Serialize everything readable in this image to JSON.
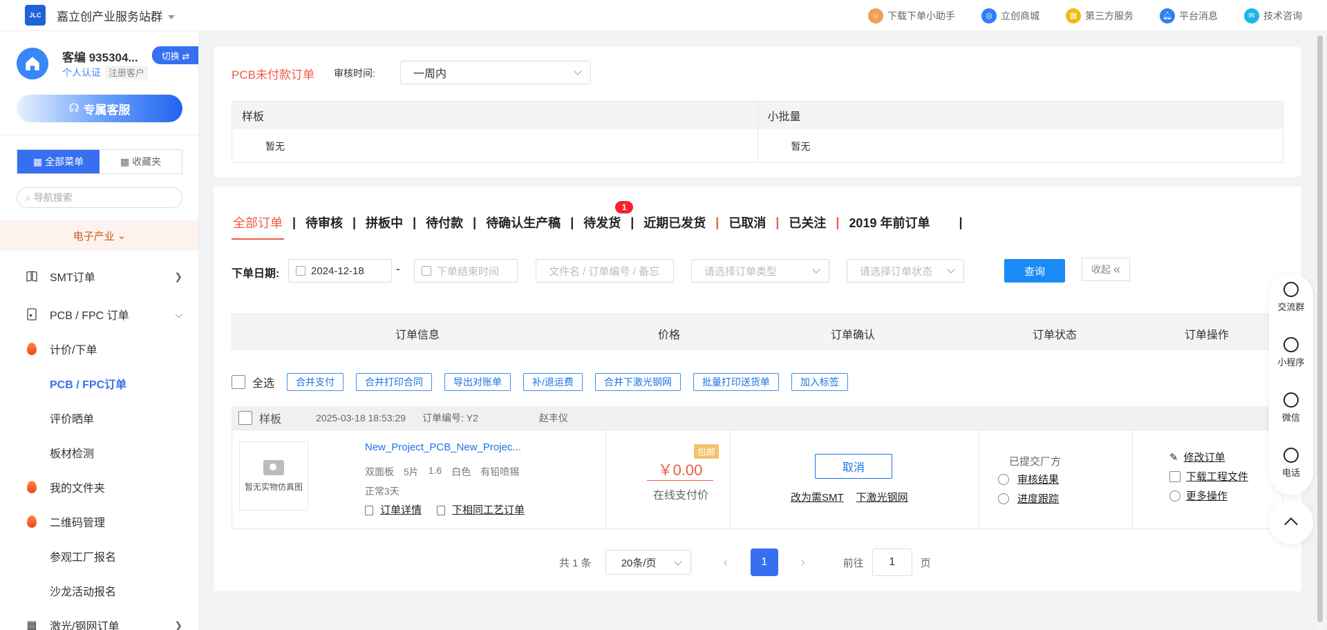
{
  "topbar": {
    "brand": "嘉立创产业服务站群",
    "logo_text": "JLC",
    "links": [
      {
        "label": "下载下单小助手",
        "icon": "assistant-icon",
        "color": "#f0a050"
      },
      {
        "label": "立创商城",
        "icon": "mall-icon",
        "color": "#2f7ef5"
      },
      {
        "label": "第三方服务",
        "icon": "grid-icon",
        "color": "#f5b90f"
      },
      {
        "label": "平台消息",
        "icon": "bell-icon",
        "color": "#2f7ef5"
      },
      {
        "label": "技术咨询",
        "icon": "chat-icon",
        "color": "#1fb5e8"
      }
    ]
  },
  "sidebar": {
    "user_name": "客编 935304...",
    "switch_label": "切换 ⇄",
    "tag_personal": "个人认证",
    "tag_registered": "注册客户",
    "service_label": "专属客服",
    "menu_all": "全部菜单",
    "menu_fav": "收藏夹",
    "search_placeholder": "导航搜索",
    "industry": "电子产业",
    "items": [
      {
        "label": "SMT订单",
        "icon": "book-icon",
        "arrow": "›"
      },
      {
        "label": "PCB / FPC 订单",
        "icon": "document-icon",
        "arrow": "⌄"
      },
      {
        "label": "计价/下单",
        "icon": "flame-icon"
      },
      {
        "label": "PCB / FPC订单"
      },
      {
        "label": "评价晒单"
      },
      {
        "label": "板材检测"
      },
      {
        "label": "我的文件夹",
        "icon": "flame-icon"
      },
      {
        "label": "二维码管理",
        "icon": "flame-icon"
      },
      {
        "label": "参观工厂报名"
      },
      {
        "label": "沙龙活动报名"
      },
      {
        "label": "激光/钢网订单",
        "icon": "grid-icon",
        "arrow": "›"
      }
    ]
  },
  "unpaid": {
    "title": "PCB未付款订单",
    "audit_label": "审核时间:",
    "audit_value": "一周内",
    "col_sample": "样板",
    "col_small": "小批量",
    "empty": "暂无"
  },
  "orders": {
    "tabs": [
      "全部订单",
      "待审核",
      "拼板中",
      "待付款",
      "待确认生产稿",
      "待发货",
      "近期已发货",
      "已取消",
      "已关注",
      "2019 年前订单"
    ],
    "badge": "1",
    "filter_label": "下单日期:",
    "start_date": "2024-12-18",
    "dash": "-",
    "end_placeholder": "下单结束时间",
    "keyword_placeholder": "文件名 / 订单编号 / 备忘",
    "type_placeholder": "请选择订单类型",
    "status_placeholder": "请选择订单状态",
    "query_label": "查询",
    "collapse_label": "收起",
    "headers": [
      "订单信息",
      "价格",
      "订单确认",
      "订单状态",
      "订单操作"
    ],
    "select_all": "全选",
    "bulk_actions": [
      "合并支付",
      "合并打印合同",
      "导出对账单",
      "补/退运费",
      "合并下激光钢网",
      "批量打印送货单",
      "加入标签"
    ],
    "row": {
      "kind": "样板",
      "time": "2025-03-18 18:53:29",
      "order_no": "订单编号: Y2",
      "person": "赵丰仪",
      "thumb_text": "暂无实物仿真图",
      "product": "New_Project_PCB_New_Projec...",
      "specs": [
        "双面板",
        "5片",
        "1.6",
        "白色",
        "有铅喷锡"
      ],
      "days": "正常3天",
      "detail_link": "订单详情",
      "same_link": "下相同工艺订单",
      "price": "￥0.00",
      "free_tag": "包邮",
      "price_sub": "在线支付价",
      "cancel": "取消",
      "to_smt": "改为需SMT",
      "to_stencil": "下激光钢网",
      "status": "已提交厂方",
      "audit_result": "审核结果",
      "progress": "进度跟踪",
      "op_edit": "修改订单",
      "op_download": "下载工程文件",
      "op_more": "更多操作"
    },
    "pager": {
      "total": "共 1 条",
      "page_size": "20条/页",
      "current": "1",
      "goto_label": "前往",
      "goto_value": "1",
      "page_unit": "页"
    }
  },
  "float": {
    "items": [
      "交流群",
      "小程序",
      "微信",
      "电话"
    ]
  }
}
